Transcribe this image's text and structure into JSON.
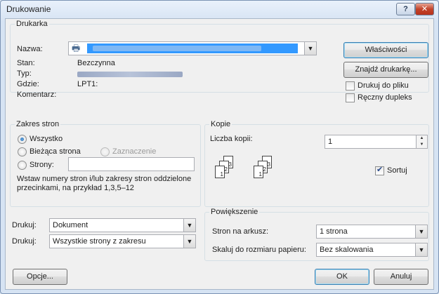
{
  "window": {
    "title": "Drukowanie",
    "help_label": "?",
    "close_label": "✕"
  },
  "printer": {
    "group_label": "Drukarka",
    "name_label": "Nazwa:",
    "status_label": "Stan:",
    "status_value": "Bezczynna",
    "type_label": "Typ:",
    "where_label": "Gdzie:",
    "where_value": "LPT1:",
    "comment_label": "Komentarz:",
    "properties_button": "Właściwości",
    "find_button": "Znajdź drukarkę...",
    "print_to_file": "Drukuj do pliku",
    "manual_duplex": "Ręczny dupleks"
  },
  "page_range": {
    "group_label": "Zakres stron",
    "all": "Wszystko",
    "current": "Bieżąca strona",
    "selection": "Zaznaczenie",
    "pages": "Strony:",
    "pages_value": "",
    "hint": "Wstaw numery stron i/lub zakresy stron oddzielone przecinkami, na przykład 1,3,5–12"
  },
  "copies": {
    "group_label": "Kopie",
    "count_label": "Liczba kopii:",
    "count_value": "1",
    "collate": "Sortuj",
    "collate_pages": [
      "3",
      "2",
      "1",
      "3",
      "2",
      "1"
    ]
  },
  "print_what": {
    "label": "Drukuj:",
    "value": "Dokument"
  },
  "print_scope": {
    "label": "Drukuj:",
    "value": "Wszystkie strony z zakresu"
  },
  "zoom": {
    "group_label": "Powiększenie",
    "pages_per_sheet_label": "Stron na arkusz:",
    "pages_per_sheet_value": "1 strona",
    "scale_label": "Skaluj do rozmiaru papieru:",
    "scale_value": "Bez skalowania"
  },
  "footer": {
    "options": "Opcje...",
    "ok": "OK",
    "cancel": "Anuluj"
  }
}
